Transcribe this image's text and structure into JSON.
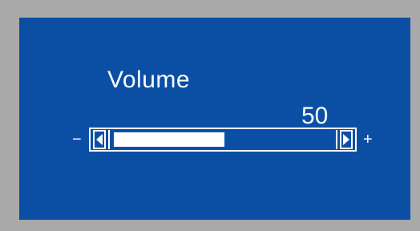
{
  "osd": {
    "title": "Volume",
    "value_text": "50",
    "minus_label": "−",
    "plus_label": "+",
    "level": 0.5,
    "colors": {
      "background": "#0b4fa5",
      "frame": "#a9a9a9",
      "foreground": "#ffffff"
    },
    "icons": {
      "left": "triangle-left-icon",
      "right": "triangle-right-icon"
    }
  }
}
